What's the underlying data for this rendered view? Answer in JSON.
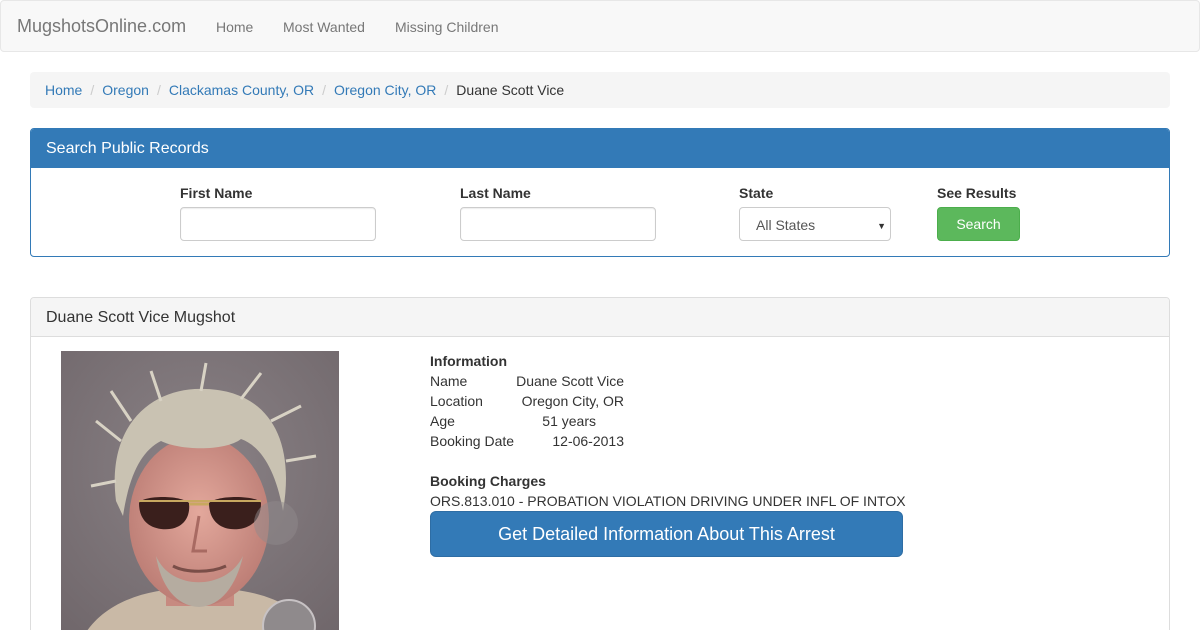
{
  "navbar": {
    "brand": "MugshotsOnline.com",
    "links": [
      "Home",
      "Most Wanted",
      "Missing Children"
    ]
  },
  "breadcrumb": {
    "items": [
      "Home",
      "Oregon",
      "Clackamas County, OR",
      "Oregon City, OR"
    ],
    "separator": "/",
    "active": "Duane Scott Vice"
  },
  "search": {
    "heading": "Search Public Records",
    "first_name_label": "First Name",
    "first_name_value": "",
    "last_name_label": "Last Name",
    "last_name_value": "",
    "state_label": "State",
    "state_selected": "All States",
    "results_label": "See Results",
    "button_label": "Search"
  },
  "mugshot": {
    "heading": "Duane Scott Vice Mugshot",
    "info_title": "Information",
    "info": [
      {
        "key": "Name",
        "value": "Duane Scott Vice"
      },
      {
        "key": "Location",
        "value": "Oregon City, OR"
      },
      {
        "key": "Age",
        "value": "51 years"
      },
      {
        "key": "Booking Date",
        "value": "12-06-2013"
      }
    ],
    "charges_title": "Booking Charges",
    "charges": [
      "ORS.813.010 - PROBATION VIOLATION DRIVING UNDER INFL OF INTOX"
    ],
    "detail_button": "Get Detailed Information About This Arrest"
  },
  "colors": {
    "primary": "#337ab7",
    "success": "#5cb85c",
    "navbar_bg": "#f8f8f8",
    "breadcrumb_bg": "#f5f5f5"
  }
}
